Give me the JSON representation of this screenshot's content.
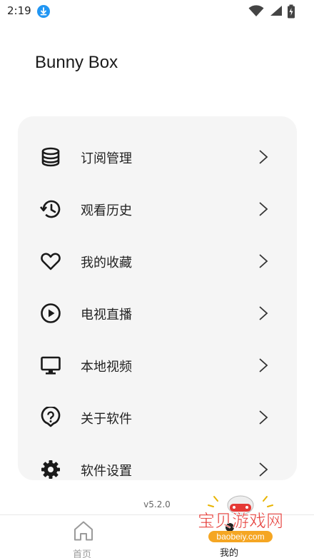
{
  "status_bar": {
    "time": "2:19",
    "icons": [
      "download-badge",
      "wifi-icon",
      "signal-icon",
      "battery-icon"
    ],
    "accent_color": "#2196f3"
  },
  "app": {
    "title": "Bunny Box"
  },
  "menu": {
    "items": [
      {
        "label": "订阅管理",
        "icon": "database-icon"
      },
      {
        "label": "观看历史",
        "icon": "history-icon"
      },
      {
        "label": "我的收藏",
        "icon": "heart-icon"
      },
      {
        "label": "电视直播",
        "icon": "play-circle-icon"
      },
      {
        "label": "本地视频",
        "icon": "monitor-icon"
      },
      {
        "label": "关于软件",
        "icon": "help-icon"
      },
      {
        "label": "软件设置",
        "icon": "gear-icon"
      }
    ],
    "card_color": "#f5f5f5"
  },
  "version": "v5.2.0",
  "bottom_nav": {
    "items": [
      {
        "label": "首页",
        "icon": "home-icon",
        "active": false
      },
      {
        "label": "我的",
        "icon": "user-icon",
        "active": true
      }
    ]
  },
  "watermark": {
    "text": "宝贝游戏网",
    "url": "baobeiy.com"
  }
}
